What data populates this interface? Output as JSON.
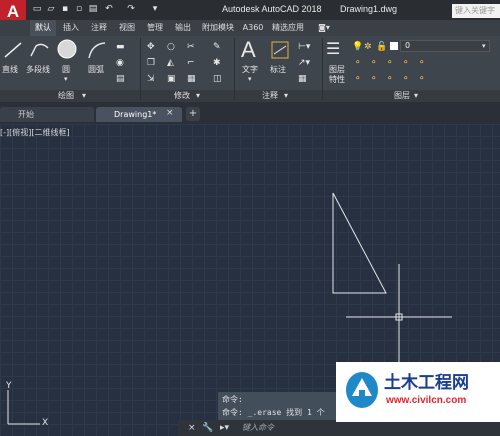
{
  "titlebar": {
    "logo_letter": "A",
    "app_title": "Autodesk AutoCAD 2018",
    "doc_title": "Drawing1.dwg",
    "search_placeholder": "键入关键字"
  },
  "ribbon_tabs": [
    "默认",
    "插入",
    "注释",
    "视图",
    "管理",
    "输出",
    "附加模块",
    "A360",
    "精选应用"
  ],
  "ribbon": {
    "draw": {
      "line": "直线",
      "polyline": "多段线",
      "circle": "圆",
      "arc": "圆弧",
      "group_label": "绘图"
    },
    "modify": {
      "group_label": "修改"
    },
    "annotation": {
      "text": "文字",
      "dimension": "标注",
      "group_label": "注释"
    },
    "layers": {
      "layer_props_line1": "图层",
      "layer_props_line2": "特性",
      "current_layer": "0",
      "group_label": "图层"
    }
  },
  "file_tabs": [
    {
      "label": "开始"
    },
    {
      "label": "Drawing1*"
    }
  ],
  "viewport": {
    "label": "[-][俯视][二维线框]"
  },
  "ucs": {
    "x": "X",
    "y": "Y"
  },
  "command": {
    "history": [
      "命令:",
      "命令: _.erase 找到 1 个"
    ],
    "prompt_placeholder": "键入命令"
  },
  "watermark": {
    "brand": "土木工程网",
    "url": "www.civilcn.com"
  },
  "colors": {
    "canvas": "#263040",
    "logo": "#c2202a",
    "crosshair": "#e6e6e6",
    "triangle": "#e6e6e6"
  }
}
